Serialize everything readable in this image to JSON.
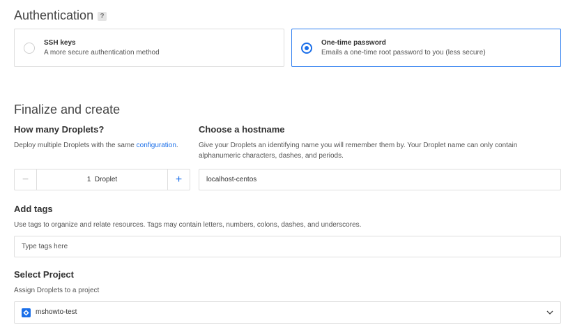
{
  "authentication": {
    "title": "Authentication",
    "help": "?",
    "options": [
      {
        "title": "SSH keys",
        "description": "A more secure authentication method",
        "selected": false
      },
      {
        "title": "One-time password",
        "description": "Emails a one-time root password to you (less secure)",
        "selected": true
      }
    ]
  },
  "finalize": {
    "title": "Finalize and create",
    "droplets": {
      "title": "How many Droplets?",
      "help_prefix": "Deploy multiple Droplets with the same ",
      "help_link": "configuration",
      "help_suffix": ".",
      "minus": "−",
      "plus": "+",
      "value": "1  Droplet"
    },
    "hostname": {
      "title": "Choose a hostname",
      "help_line1": "Give your Droplets an identifying name you will remember them by. Your Droplet name can only contain",
      "help_line2": "alphanumeric characters, dashes, and periods.",
      "value": "localhost-centos"
    }
  },
  "tags": {
    "title": "Add tags",
    "help": "Use tags to organize and relate resources. Tags may contain letters, numbers, colons, dashes, and underscores.",
    "placeholder": "Type tags here"
  },
  "project": {
    "title": "Select Project",
    "help": "Assign Droplets to a project",
    "selected": "mshowto-test",
    "icon": "project-icon"
  },
  "colors": {
    "accent": "#1b6fe9",
    "border": "#dedede",
    "selected_border": "#2f7ff0"
  }
}
